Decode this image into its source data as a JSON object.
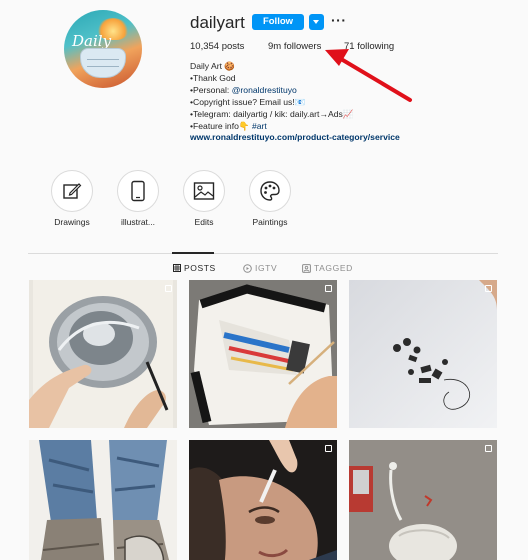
{
  "profile": {
    "username": "dailyart",
    "follow_label": "Follow",
    "more_label": "···",
    "stats": {
      "posts": "10,354 posts",
      "followers": "9m followers",
      "following": "71 following"
    },
    "bio": [
      {
        "text": "Daily Art 🍪"
      },
      {
        "text": "•Thank God"
      },
      {
        "prefix": "•Personal: ",
        "mention": "@ronaldrestituyo"
      },
      {
        "text": "•Copyright issue? Email us!📧"
      },
      {
        "text": "•Telegram: dailyartig / kik: daily.art→Ads📈"
      },
      {
        "prefix": "•Feature info👇 ",
        "mention": "#art"
      }
    ],
    "website": "www.ronaldrestituyo.com/product-category/service",
    "avatar_text": "Daily"
  },
  "highlights": [
    {
      "label": "Drawings",
      "icon": "pencil-icon"
    },
    {
      "label": "illustrat...",
      "icon": "tablet-icon"
    },
    {
      "label": "Edits",
      "icon": "image-icon"
    },
    {
      "label": "Paintings",
      "icon": "palette-icon"
    }
  ],
  "tabs": [
    {
      "label": "POSTS",
      "icon": "grid-icon",
      "active": true
    },
    {
      "label": "IGTV",
      "icon": "igtv-icon",
      "active": false
    },
    {
      "label": "TAGGED",
      "icon": "tag-icon",
      "active": false
    }
  ],
  "posts": [
    {
      "subject": "metal-bowl-drawing",
      "multi": true
    },
    {
      "subject": "hyperreal-paint-tube-drawing",
      "multi": true
    },
    {
      "subject": "paper-craft-sculpture",
      "multi": true
    },
    {
      "subject": "jeans-and-boots-painting",
      "multi": false
    },
    {
      "subject": "face-portrait-drawing",
      "multi": true
    },
    {
      "subject": "ostrich-wall-graffiti",
      "multi": true
    }
  ],
  "colors": {
    "follow_blue": "#0095f6",
    "annotation_arrow": "#e0101a",
    "link_blue": "#00376b"
  }
}
